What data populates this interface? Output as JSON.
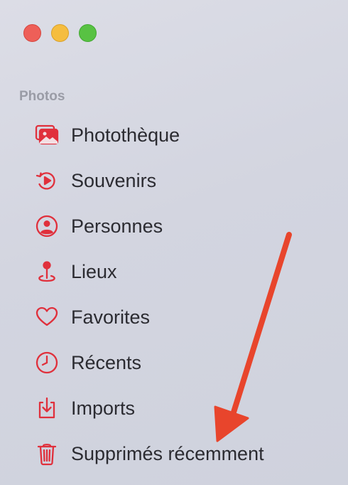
{
  "window": {
    "controls": [
      {
        "name": "close",
        "color": "#ee5f58"
      },
      {
        "name": "minimize",
        "color": "#f5bd3f"
      },
      {
        "name": "zoom",
        "color": "#58c243"
      }
    ]
  },
  "sidebar": {
    "section_title": "Photos",
    "accent_color": "#e0303c",
    "items": [
      {
        "label": "Photothèque",
        "icon": "photo-library-icon"
      },
      {
        "label": "Souvenirs",
        "icon": "memories-icon"
      },
      {
        "label": "Personnes",
        "icon": "person-icon"
      },
      {
        "label": "Lieux",
        "icon": "map-pin-icon"
      },
      {
        "label": "Favorites",
        "icon": "heart-icon"
      },
      {
        "label": "Récents",
        "icon": "clock-icon"
      },
      {
        "label": "Imports",
        "icon": "import-tray-icon"
      },
      {
        "label": "Supprimés récemment",
        "icon": "trash-icon"
      }
    ]
  },
  "annotation": {
    "type": "arrow",
    "color": "#e8452c",
    "points_to": "Supprimés récemment"
  }
}
